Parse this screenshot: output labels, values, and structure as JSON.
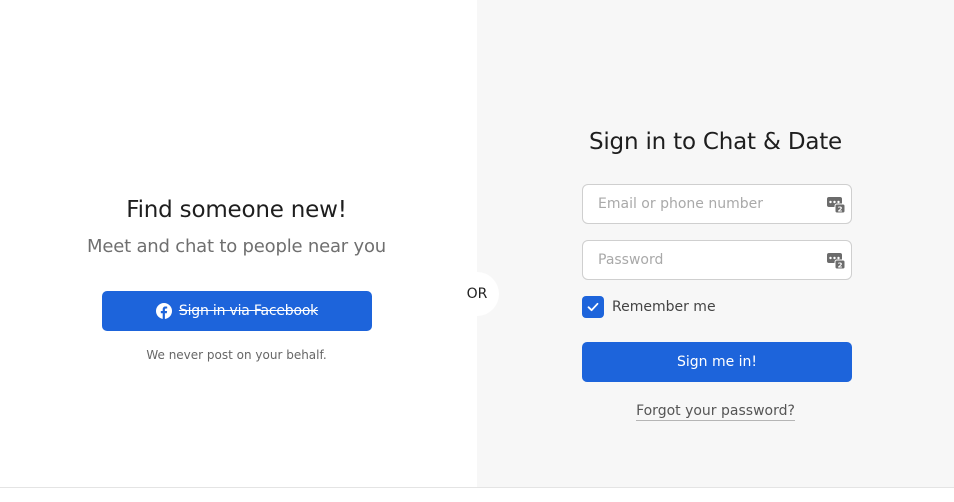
{
  "left": {
    "headline": "Find someone new!",
    "subheadline": "Meet and chat to people near you",
    "facebook_button_label": "Sign in via Facebook",
    "disclaimer": "We never post on your behalf."
  },
  "divider_label": "OR",
  "signin": {
    "title": "Sign in to Chat & Date",
    "email_placeholder": "Email or phone number",
    "email_value": "",
    "password_placeholder": "Password",
    "password_value": "",
    "remember_label": "Remember me",
    "remember_checked": true,
    "submit_label": "Sign me in!",
    "forgot_label": "Forgot your password?"
  },
  "icons": {
    "facebook": "facebook-icon",
    "password_manager": "key-icon",
    "check": "check-icon"
  },
  "colors": {
    "primary": "#1d64db",
    "right_panel_bg": "#f7f7f7"
  }
}
